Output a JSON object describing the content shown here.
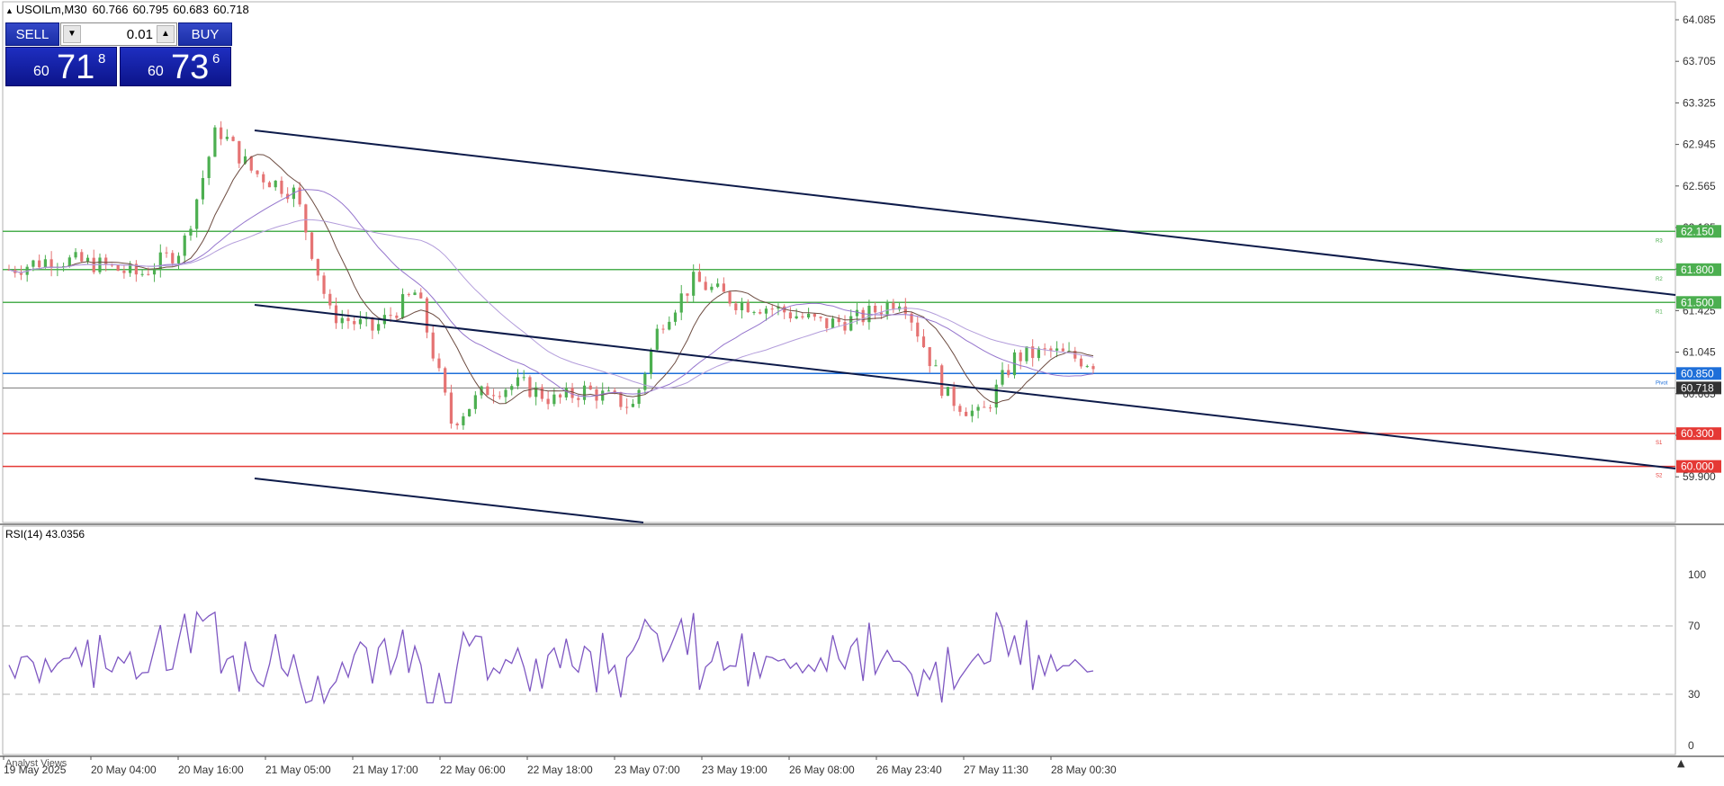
{
  "header": {
    "symbol": "USOILm,M30",
    "open": "60.766",
    "high": "60.795",
    "low": "60.683",
    "close": "60.718"
  },
  "trade_panel": {
    "sell_label": "SELL",
    "buy_label": "BUY",
    "lot_value": "0.01",
    "sell_price": {
      "small": "60",
      "big": "71",
      "sup": "8"
    },
    "buy_price": {
      "small": "60",
      "big": "73",
      "sup": "6"
    }
  },
  "price_axis": {
    "ticks": [
      "64.085",
      "63.705",
      "63.325",
      "62.945",
      "62.565",
      "62.185",
      "61.805",
      "61.425",
      "61.045",
      "60.665",
      "60.285",
      "59.900"
    ],
    "tick_values": [
      64.085,
      63.705,
      63.325,
      62.945,
      62.565,
      62.185,
      61.805,
      61.425,
      61.045,
      60.665,
      60.285,
      59.905
    ]
  },
  "levels": [
    {
      "name": "R3",
      "value": 62.15,
      "label": "62.150",
      "color": "#4caf50"
    },
    {
      "name": "R2",
      "value": 61.8,
      "label": "61.800",
      "color": "#4caf50"
    },
    {
      "name": "R1",
      "value": 61.5,
      "label": "61.500",
      "color": "#4caf50"
    },
    {
      "name": "Pivot",
      "value": 60.85,
      "label": "60.850",
      "color": "#1e6fd9"
    },
    {
      "name": "S1",
      "value": 60.3,
      "label": "60.300",
      "color": "#e53935"
    },
    {
      "name": "S2",
      "value": 60.0,
      "label": "60.000",
      "color": "#e53935"
    }
  ],
  "current_price": {
    "value": 60.718,
    "label": "60.718",
    "color": "#333333"
  },
  "rsi": {
    "title": "RSI(14) 43.0356",
    "axis_labels": [
      "100",
      "70",
      "30",
      "0"
    ],
    "axis_values": [
      100,
      70,
      30,
      0
    ]
  },
  "time_axis": {
    "labels": [
      "19 May 2025",
      "20 May 04:00",
      "20 May 16:00",
      "21 May 05:00",
      "21 May 17:00",
      "22 May 06:00",
      "22 May 18:00",
      "23 May 07:00",
      "23 May 19:00",
      "26 May 08:00",
      "26 May 23:40",
      "27 May 11:30",
      "28 May 00:30"
    ]
  },
  "footer": {
    "analyst_views": "Analyst Views"
  },
  "colors": {
    "bull": "#4caf50",
    "bear": "#e57373",
    "rsi_line": "#7e57c2",
    "ma_fast": "#6d4c41",
    "ma_slow": "#9575cd",
    "channel": "#0d1b4a"
  }
}
